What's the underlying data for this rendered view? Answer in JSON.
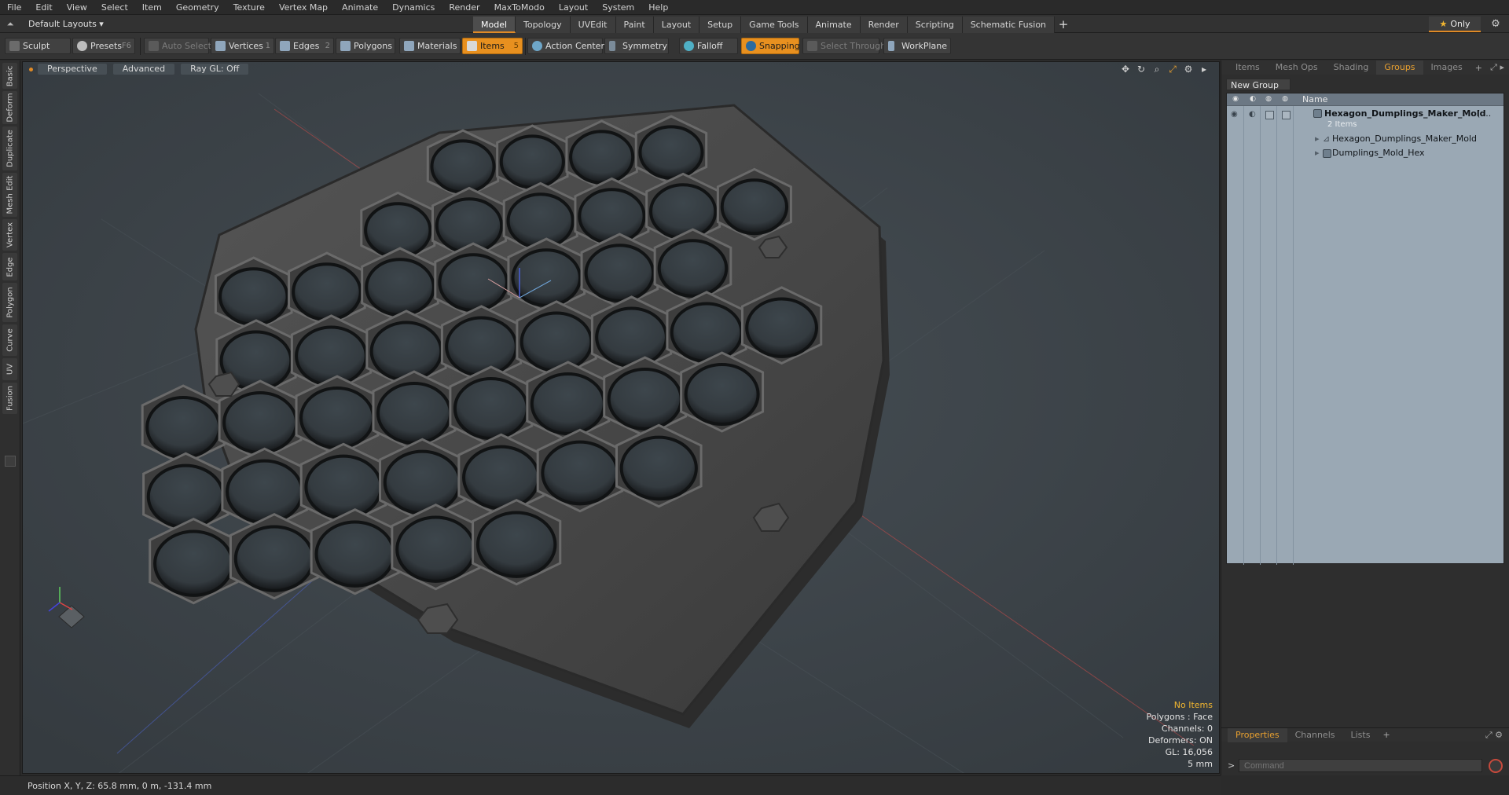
{
  "menu": [
    "File",
    "Edit",
    "View",
    "Select",
    "Item",
    "Geometry",
    "Texture",
    "Vertex Map",
    "Animate",
    "Dynamics",
    "Render",
    "MaxToModo",
    "Layout",
    "System",
    "Help"
  ],
  "layout": {
    "dropdown": "Default Layouts ▾",
    "only_label": "Only"
  },
  "tabs": [
    {
      "label": "Model",
      "active": true
    },
    {
      "label": "Topology"
    },
    {
      "label": "UVEdit"
    },
    {
      "label": "Paint"
    },
    {
      "label": "Layout"
    },
    {
      "label": "Setup"
    },
    {
      "label": "Game Tools"
    },
    {
      "label": "Animate"
    },
    {
      "label": "Render"
    },
    {
      "label": "Scripting"
    },
    {
      "label": "Schematic Fusion"
    }
  ],
  "toolbar": {
    "sculpt": "Sculpt",
    "presets": "Presets",
    "presets_key": "F6",
    "auto_select": "Auto Select",
    "vertices": "Vertices",
    "vertices_key": "1",
    "edges": "Edges",
    "edges_key": "2",
    "polygons": "Polygons",
    "materials": "Materials",
    "items": "Items",
    "items_key": "5",
    "action_center": "Action Center",
    "symmetry": "Symmetry",
    "falloff": "Falloff",
    "snapping": "Snapping",
    "select_through": "Select Through",
    "workplane": "WorkPlane"
  },
  "left_tabs": [
    "Basic",
    "Deform",
    "Duplicate",
    "Mesh Edit",
    "Vertex",
    "Edge",
    "Polygon",
    "Curve",
    "UV",
    "Fusion"
  ],
  "viewport": {
    "view": "Perspective",
    "mode": "Advanced",
    "raygl": "Ray GL: Off",
    "info": {
      "items": "No Items",
      "polygons": "Polygons : Face",
      "channels": "Channels: 0",
      "deformers": "Deformers: ON",
      "gl": "GL: 16,056",
      "scale": "5 mm"
    }
  },
  "right_panel": {
    "tabs": [
      {
        "label": "Items"
      },
      {
        "label": "Mesh Ops"
      },
      {
        "label": "Shading"
      },
      {
        "label": "Groups",
        "active": true
      },
      {
        "label": "Images"
      }
    ],
    "new_group": "New Group",
    "column_name": "Name",
    "tree": {
      "group_name": "Hexagon_Dumplings_Maker_Mold",
      "group_suffix": "( ...",
      "group_count": "2 Items",
      "child1": "Hexagon_Dumplings_Maker_Mold",
      "child2": "Dumplings_Mold_Hex"
    },
    "bottom_tabs": [
      {
        "label": "Properties",
        "active": true
      },
      {
        "label": "Channels"
      },
      {
        "label": "Lists"
      }
    ],
    "command_placeholder": "Command"
  },
  "status": {
    "position": "Position X, Y, Z:   65.8 mm, 0 m, -131.4 mm"
  },
  "colors": {
    "accent": "#e08a26",
    "viewport_bg": "#3b4247",
    "mold": "#474747"
  }
}
